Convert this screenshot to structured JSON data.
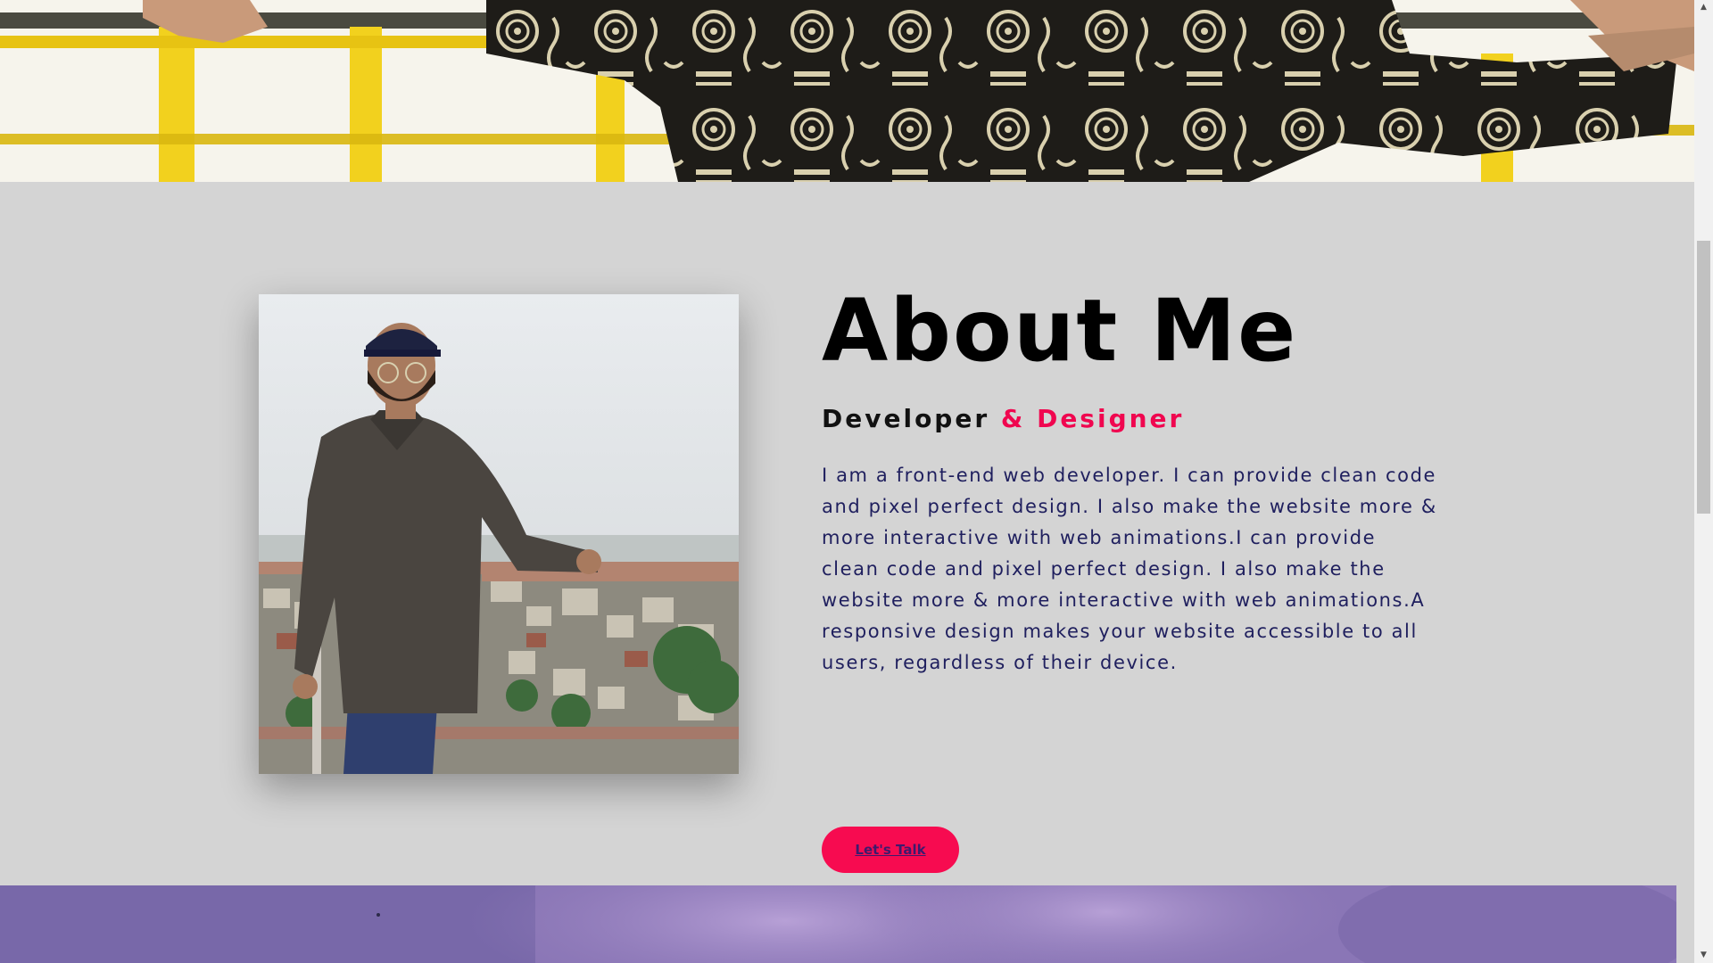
{
  "about": {
    "title": "About Me",
    "subtitle_primary": "Developer",
    "subtitle_accent": "& Designer",
    "description": "I am a front-end web developer. I can provide clean code and pixel perfect design. I also make the website more & more interactive with web animations.I can provide clean code and pixel perfect design. I also make the website more & more interactive with web animations.A responsive design makes your website accessible to all users, regardless of their device.",
    "cta_label": "Let's Talk"
  },
  "colors": {
    "section_background": "#d4d4d4",
    "accent": "#f0064f",
    "button_background": "#f70b50",
    "body_text": "#1f1f5e",
    "heading": "#000000"
  },
  "icons": {
    "scroll_up": "scroll-up-arrow-icon",
    "scroll_down": "scroll-down-arrow-icon"
  }
}
